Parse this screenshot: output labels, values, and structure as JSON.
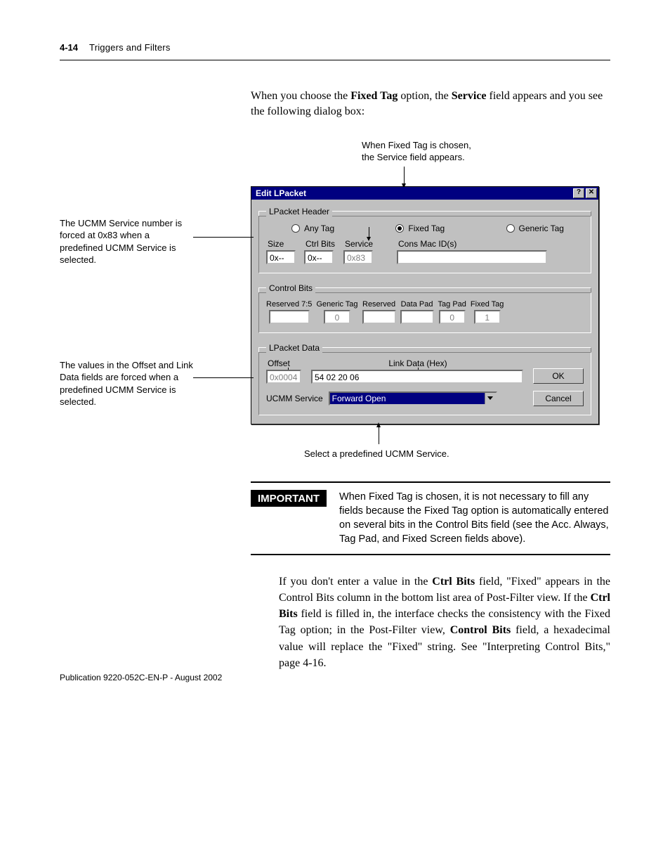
{
  "page": {
    "number": "4-14",
    "chapter": "Triggers and Filters",
    "pub": "Publication 9220-052C-EN-P - August 2002"
  },
  "intro": {
    "p1_a": "When you choose the ",
    "p1_b": "Fixed Tag",
    "p1_c": " option, the ",
    "p1_d": "Service",
    "p1_e": " field appears and you see the following dialog box:"
  },
  "captions": {
    "top1": "When Fixed Tag is chosen,",
    "top2": "the Service field appears.",
    "side1": "The UCMM Service number is forced at 0x83 when a predefined UCMM Service is selected.",
    "side2": "The values in the Offset and Link Data fields are forced when a predefined UCMM Service is selected.",
    "bottom": "Select a predefined UCMM Service."
  },
  "dialog": {
    "title": "Edit LPacket",
    "help": "?",
    "close": "✕",
    "group_hdr": "LPacket Header",
    "any": "Any Tag",
    "fixed": "Fixed Tag",
    "generic": "Generic Tag",
    "size_l": "Size",
    "ctrl_l": "Ctrl Bits",
    "service_l": "Service",
    "cons_l": "Cons Mac ID(s)",
    "size_v": "0x--",
    "ctrl_v": "0x--",
    "service_v": "0x83",
    "cons_v": "",
    "group_cb": "Control Bits",
    "cb_res75": "Reserved 7:5",
    "cb_gen": "Generic Tag",
    "cb_res": "Reserved",
    "cb_data": "Data Pad",
    "cb_tag": "Tag Pad",
    "cb_fix": "Fixed Tag",
    "cb_res75_v": "",
    "cb_gen_v": "0",
    "cb_res_v": "",
    "cb_data_v": "",
    "cb_tag_v": "0",
    "cb_fix_v": "1",
    "group_data": "LPacket Data",
    "offset_l": "Offset",
    "link_l": "Link Data (Hex)",
    "offset_v": "0x0004",
    "link_v": "54 02 20 06",
    "ucmm_l": "UCMM Service",
    "ucmm_v": "Forward Open",
    "ok": "OK",
    "cancel": "Cancel"
  },
  "important": {
    "badge": "IMPORTANT",
    "t1": "When ",
    "t2": "Fixed Tag",
    "t3": " is chosen, it is not necessary to fill any fields because the Fixed Tag option is automatically entered on several bits in the ",
    "t4": "Control Bits",
    "t5": " field (see the Acc. Always, Tag Pad, and Fixed Screen fields above)."
  },
  "body2": {
    "a": "If you don't enter a value in the ",
    "b": "Ctrl Bits",
    "c": " field, \"Fixed\" appears in the Control Bits column in the bottom list area of Post-Filter view. If the ",
    "d": "Ctrl Bits",
    "e": " field is filled in, the interface checks the consistency with the Fixed Tag option; in the Post-Filter view, ",
    "f": "Control Bits",
    "g": " field, a hexadecimal value will replace the \"Fixed\" string. See \"Interpreting Control Bits,\" page 4-16."
  }
}
